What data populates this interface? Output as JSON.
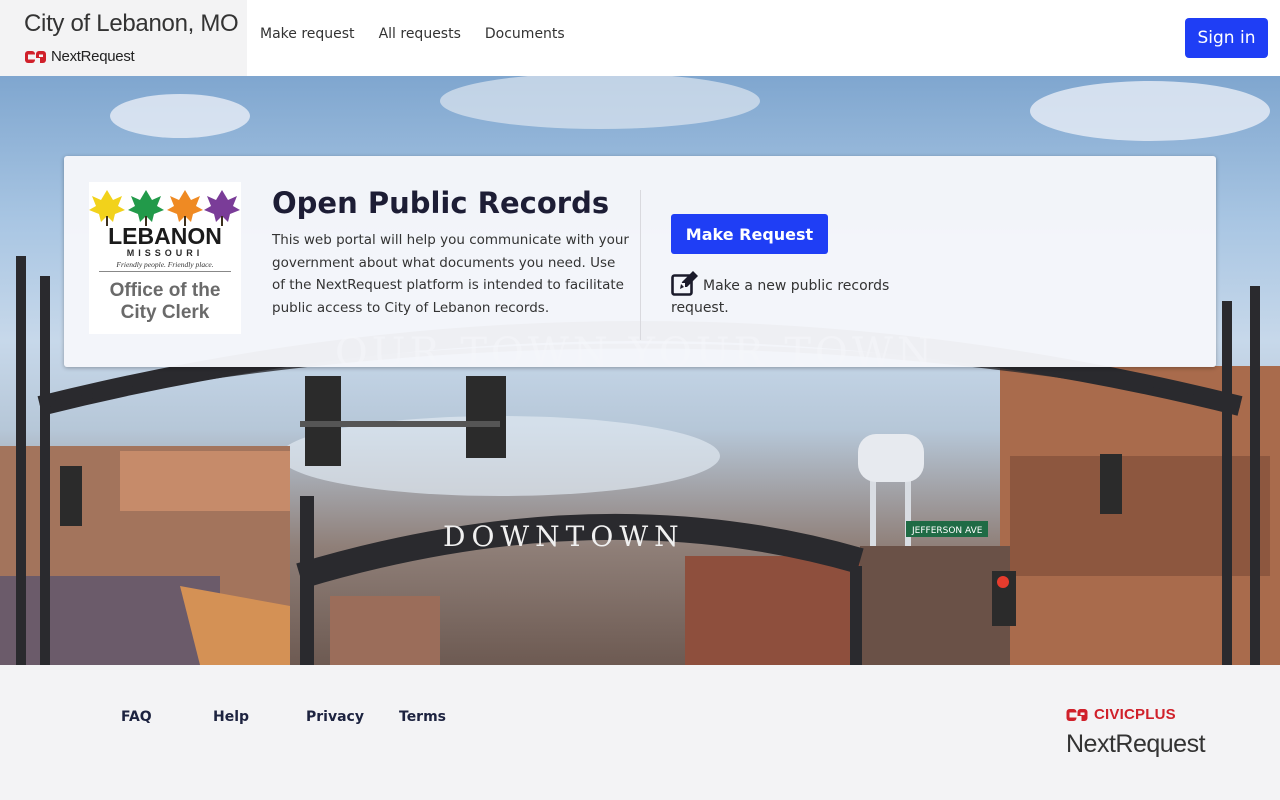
{
  "header": {
    "city_name": "City of Lebanon, MO",
    "product_name": "NextRequest",
    "nav": [
      {
        "label": "Make request"
      },
      {
        "label": "All requests"
      },
      {
        "label": "Documents"
      }
    ],
    "signin_label": "Sign in"
  },
  "hero": {
    "sign_text_top": "OUR TOWN YOUR TOWN",
    "sign_text_bottom": "DOWNTOWN",
    "street_sign": "JEFFERSON AVE"
  },
  "card": {
    "logo": {
      "name": "LEBANON",
      "state": "MISSOURI",
      "tagline": "Friendly people.  Friendly place.",
      "office_line1": "Office of the",
      "office_line2": "City Clerk"
    },
    "title": "Open Public Records",
    "description": "This web portal will help you communicate with your government about what documents you need. Use of the NextRequest platform is intended to facilitate public access to City of Lebanon records.",
    "make_request_label": "Make Request",
    "make_request_desc": "Make a new public records request.",
    "icon": "edit-icon"
  },
  "footer": {
    "links": [
      {
        "label": "FAQ"
      },
      {
        "label": "Help"
      },
      {
        "label": "Privacy"
      },
      {
        "label": "Terms"
      }
    ],
    "brand_top": "CIVICPLUS",
    "brand_bottom": "NextRequest"
  },
  "colors": {
    "accent": "#1f3ef5",
    "brand_red": "#d0202a",
    "title_dark": "#1d1d35"
  }
}
